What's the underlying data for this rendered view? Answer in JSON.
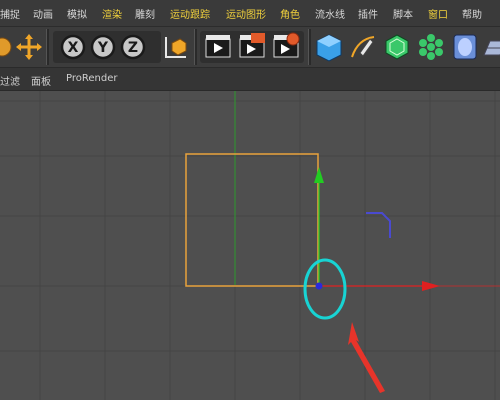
{
  "menubar": {
    "items": [
      {
        "label": "捕捉",
        "highlight": false
      },
      {
        "label": "动画",
        "highlight": false
      },
      {
        "label": "模拟",
        "highlight": false
      },
      {
        "label": "渲染",
        "highlight": true
      },
      {
        "label": "雕刻",
        "highlight": false
      },
      {
        "label": "运动跟踪",
        "highlight": true
      },
      {
        "label": "运动图形",
        "highlight": true
      },
      {
        "label": "角色",
        "highlight": true
      },
      {
        "label": "流水线",
        "highlight": false
      },
      {
        "label": "插件",
        "highlight": false
      },
      {
        "label": "脚本",
        "highlight": false
      },
      {
        "label": "窗口",
        "highlight": true
      },
      {
        "label": "帮助",
        "highlight": false
      }
    ]
  },
  "toolbar": {
    "icons": [
      "rotate-partial-icon",
      "move-icon",
      "x-axis-lock-icon",
      "y-axis-lock-icon",
      "z-axis-lock-icon",
      "coordinate-system-icon",
      "render-view-icon",
      "render-picture-viewer-icon",
      "render-settings-icon",
      "cube-primitive-icon",
      "pen-spline-icon",
      "subdivision-surface-icon",
      "cloner-icon",
      "deformer-icon",
      "floor-icon"
    ],
    "axis_labels": {
      "x": "X",
      "y": "Y",
      "z": "Z"
    }
  },
  "subbar": {
    "items": [
      "过滤",
      "面板",
      "ProRender"
    ]
  },
  "colors": {
    "selection_box": "#e8a23c",
    "y_axis": "#22cc22",
    "x_axis": "#e02020",
    "annotation_circle": "#18d4d4",
    "annotation_arrow": "#e8342a",
    "axis_point": "#2a2adc",
    "highlight_menu_text": "#f2d23c"
  }
}
